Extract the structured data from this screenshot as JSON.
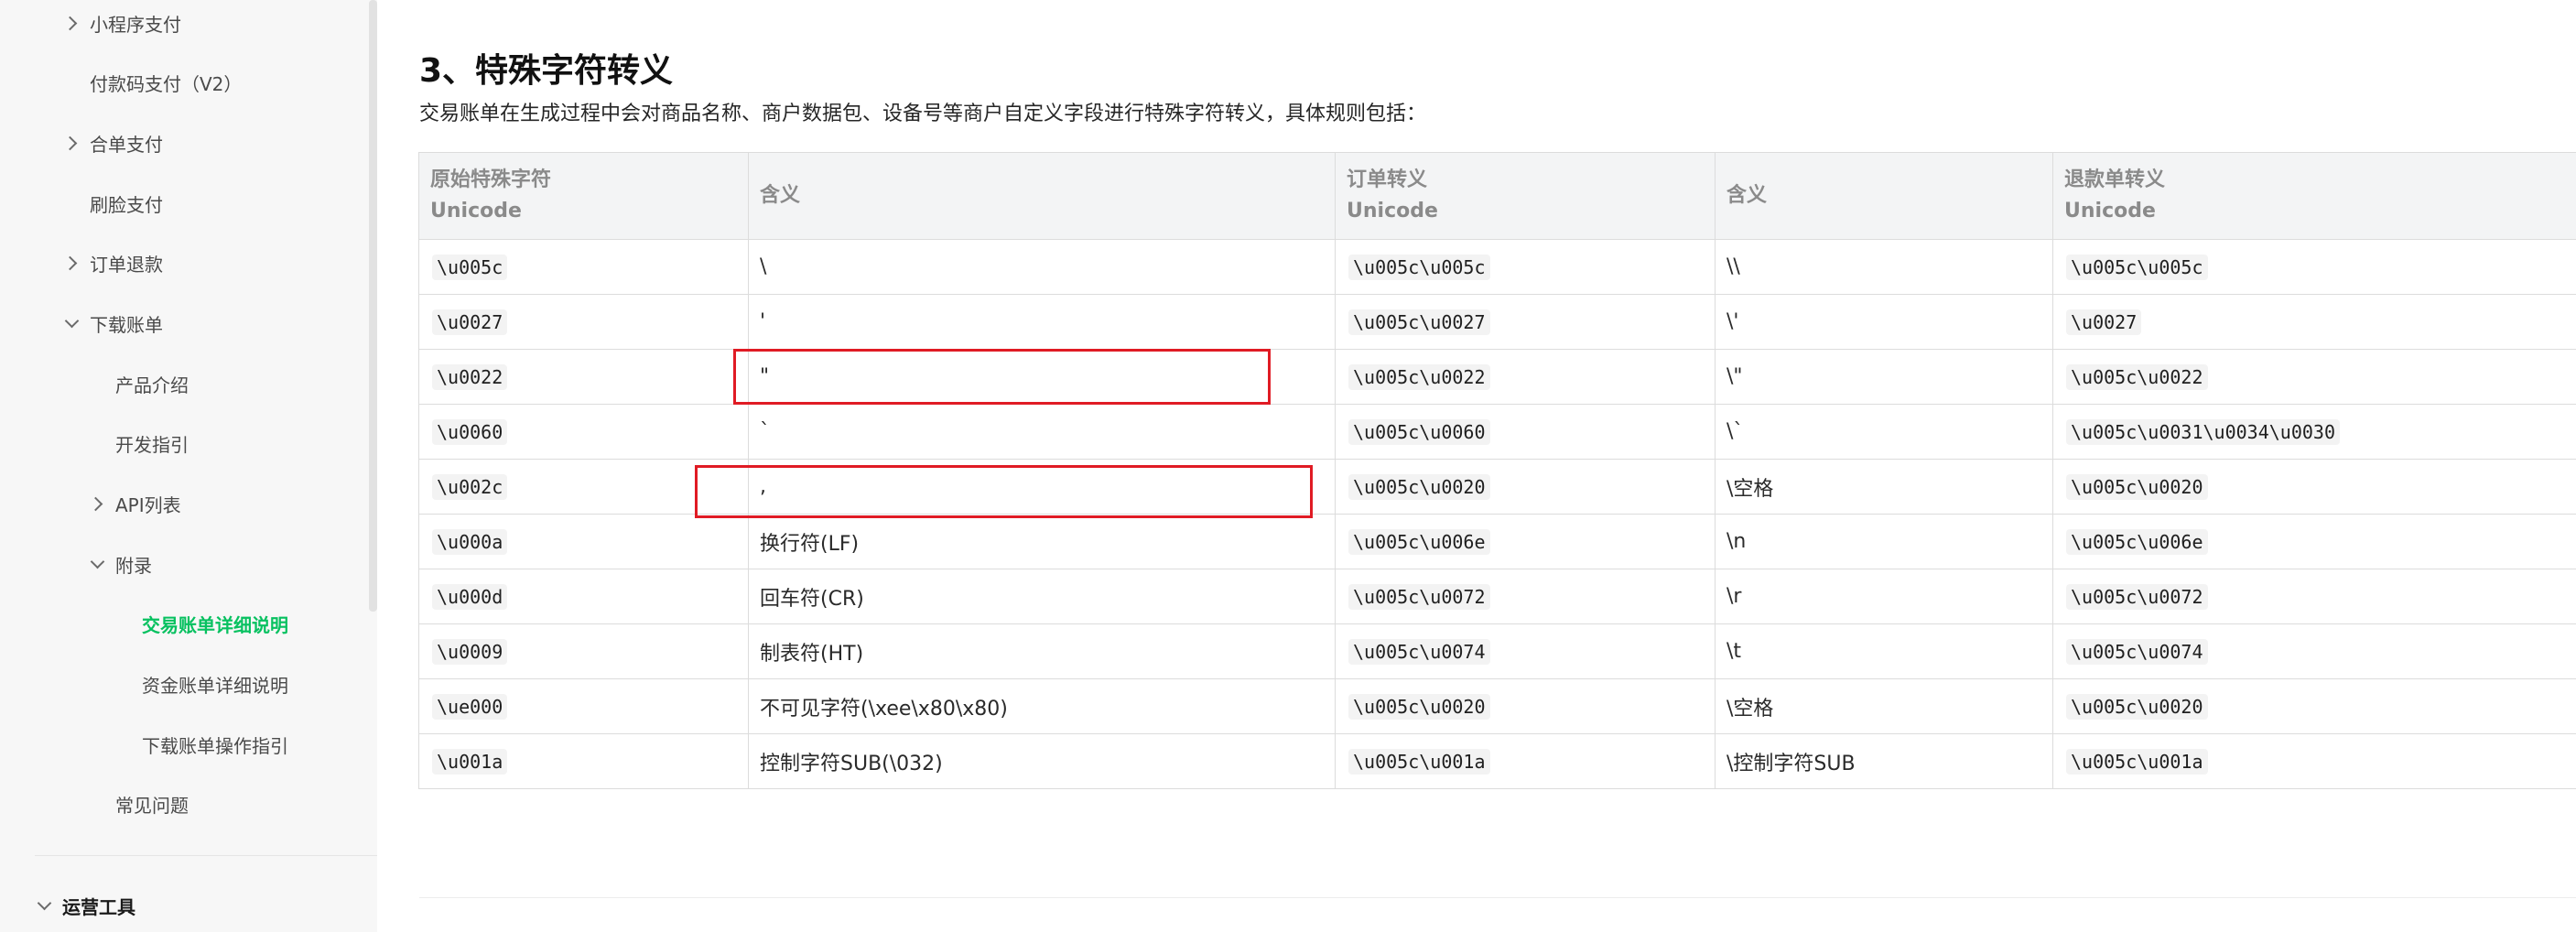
{
  "sidebar": {
    "items": [
      {
        "label": "小程序支付",
        "expander": "right"
      },
      {
        "label": "付款码支付（V2）",
        "expander": null
      },
      {
        "label": "合单支付",
        "expander": "right"
      },
      {
        "label": "刷脸支付",
        "expander": null
      },
      {
        "label": "订单退款",
        "expander": "right"
      },
      {
        "label": "下载账单",
        "expander": "down"
      },
      {
        "label": "产品介绍",
        "expander": null
      },
      {
        "label": "开发指引",
        "expander": null
      },
      {
        "label": "API列表",
        "expander": "right"
      },
      {
        "label": "附录",
        "expander": "down"
      },
      {
        "label": "交易账单详细说明",
        "expander": null,
        "active": true
      },
      {
        "label": "资金账单详细说明",
        "expander": null
      },
      {
        "label": "下载账单操作指引",
        "expander": null
      },
      {
        "label": "常见问题",
        "expander": null
      }
    ],
    "section": {
      "label": "运营工具",
      "expander": "down"
    }
  },
  "content": {
    "title": "3、特殊字符转义",
    "intro": "交易账单在生成过程中会对商品名称、商户数据包、设备号等商户自定义字段进行特殊字符转义，具体规则包括："
  },
  "table": {
    "headers": [
      [
        "原始特殊字符",
        "Unicode"
      ],
      [
        "含义",
        ""
      ],
      [
        "订单转义",
        "Unicode"
      ],
      [
        "含义",
        ""
      ],
      [
        "退款单转义",
        "Unicode"
      ]
    ],
    "rows": [
      [
        "\\u005c",
        "\\",
        "\\u005c\\u005c",
        "\\\\",
        "\\u005c\\u005c"
      ],
      [
        "\\u0027",
        "'",
        "\\u005c\\u0027",
        "\\'",
        "\\u0027"
      ],
      [
        "\\u0022",
        "\"",
        "\\u005c\\u0022",
        "\\\"",
        "\\u005c\\u0022"
      ],
      [
        "\\u0060",
        "`",
        "\\u005c\\u0060",
        "\\`",
        "\\u005c\\u0031\\u0034\\u0030"
      ],
      [
        "\\u002c",
        ",",
        "\\u005c\\u0020",
        "\\空格",
        "\\u005c\\u0020"
      ],
      [
        "\\u000a",
        "换行符(LF)",
        "\\u005c\\u006e",
        "\\n",
        "\\u005c\\u006e"
      ],
      [
        "\\u000d",
        "回车符(CR)",
        "\\u005c\\u0072",
        "\\r",
        "\\u005c\\u0072"
      ],
      [
        "\\u0009",
        "制表符(HT)",
        "\\u005c\\u0074",
        "\\t",
        "\\u005c\\u0074"
      ],
      [
        "\\ue000",
        "不可见字符(\\xee\\x80\\x80)",
        "\\u005c\\u0020",
        "\\空格",
        "\\u005c\\u0020"
      ],
      [
        "\\u001a",
        "控制字符SUB(\\032)",
        "\\u005c\\u001a",
        "\\控制字符SUB",
        "\\u005c\\u001a"
      ]
    ],
    "highlighted_rows": [
      2,
      4
    ],
    "highlight_color": "#e01b24"
  },
  "colors": {
    "active": "#07c160",
    "sidebar_bg": "#f7f7f7",
    "header_bg": "#f3f4f5"
  }
}
